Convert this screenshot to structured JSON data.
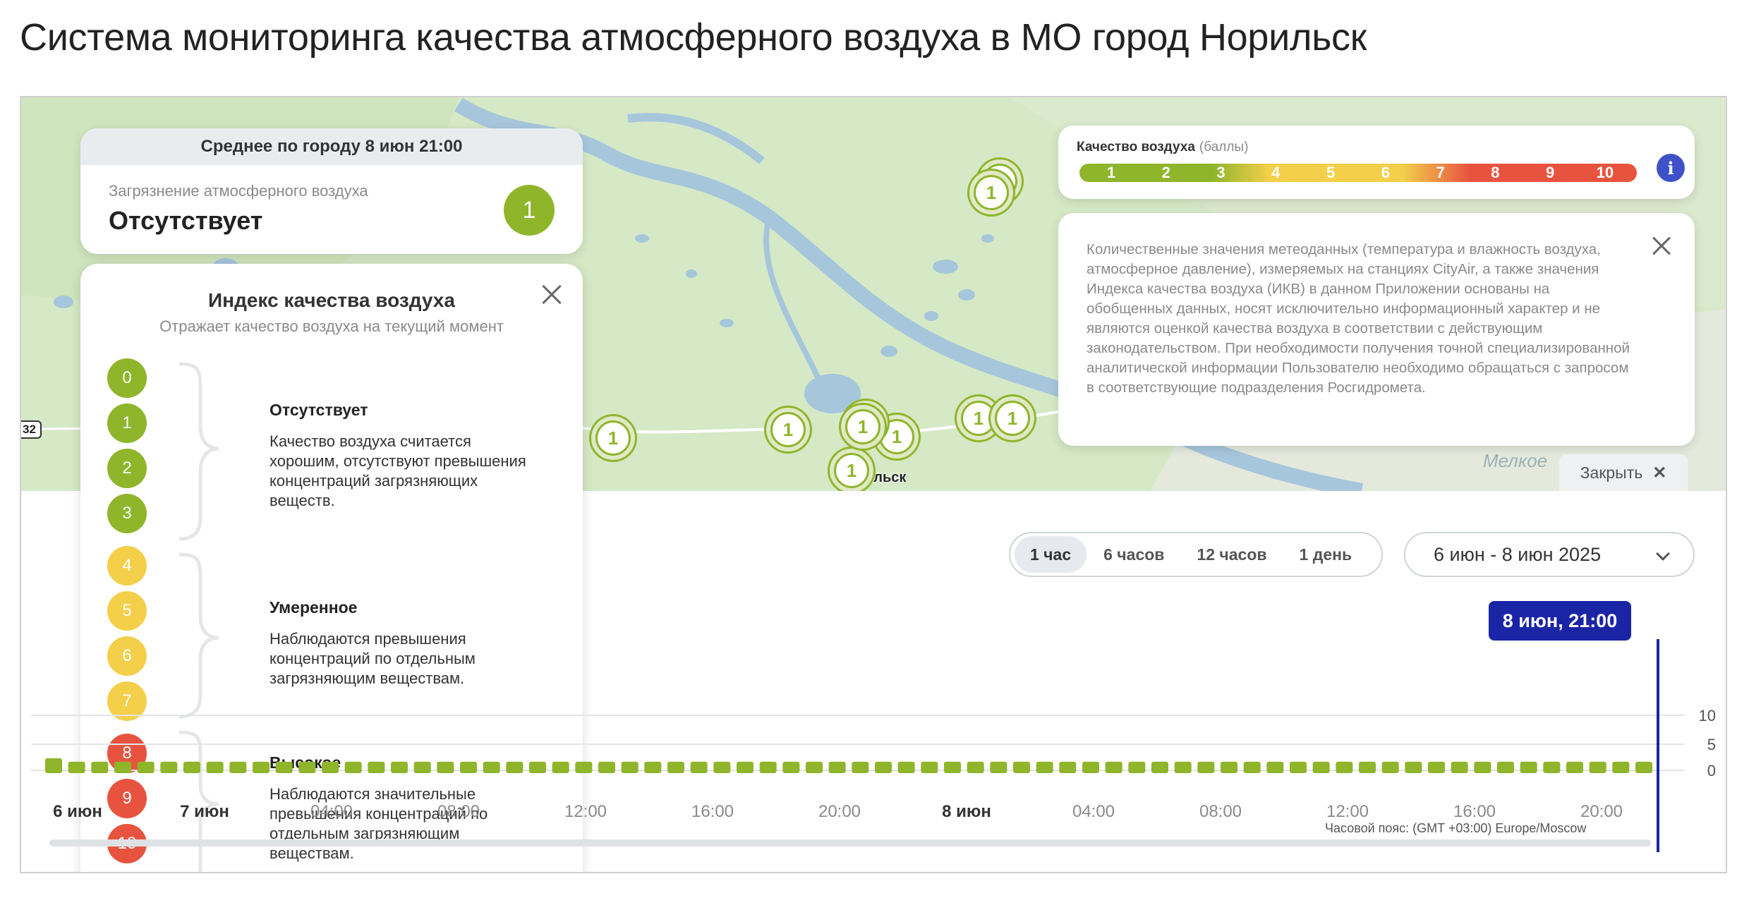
{
  "page": {
    "title": "Система мониторинга качества атмосферного воздуха в МО город Норильск"
  },
  "map": {
    "road_badge": "32",
    "water_label": "Мелкое",
    "city_label": "ильск",
    "markers": [
      "1",
      "1",
      "1",
      "1",
      "1",
      "1",
      "1",
      "1",
      "1",
      "1"
    ]
  },
  "average": {
    "header": "Среднее по городу 8 июн 21:00",
    "label": "Загрязнение атмосферного воздуха",
    "value": "Отсутствует",
    "index": "1",
    "color": "#8fb52b"
  },
  "index_panel": {
    "title": "Индекс качества воздуха",
    "subtitle": "Отражает качество воздуха на текущий момент",
    "levels": [
      {
        "value": "0",
        "color": "#8fb52b"
      },
      {
        "value": "1",
        "color": "#8fb52b"
      },
      {
        "value": "2",
        "color": "#8fb52b"
      },
      {
        "value": "3",
        "color": "#8fb52b"
      },
      {
        "value": "4",
        "color": "#f3cf4a"
      },
      {
        "value": "5",
        "color": "#f3cf4a"
      },
      {
        "value": "6",
        "color": "#f3cf4a"
      },
      {
        "value": "7",
        "color": "#f3cf4a"
      },
      {
        "value": "8",
        "color": "#e8533f"
      },
      {
        "value": "9",
        "color": "#e8533f"
      },
      {
        "value": "10",
        "color": "#e8533f"
      }
    ],
    "categories": [
      {
        "title": "Отсутствует",
        "description": "Качество воздуха считается хорошим, отсутствуют превышения концентраций загрязняющих веществ."
      },
      {
        "title": "Умеренное",
        "description": "Наблюдаются превышения концентраций по отдельным загрязняющим веществам."
      },
      {
        "title": "Высокое",
        "description": "Наблюдаются значительные превышения концентраций по отдельным загрязняющим веществам."
      }
    ]
  },
  "legend": {
    "title": "Качество воздуха",
    "unit": "(баллы)",
    "values": [
      "1",
      "2",
      "3",
      "4",
      "5",
      "6",
      "7",
      "8",
      "9",
      "10"
    ],
    "info_icon": "info-icon"
  },
  "disclaimer": {
    "text": "Количественные значения метеоданных (температура и влажность воздуха, атмосферное давление), измеряемых на станциях CityAir, а также значения Индекса качества воздуха (ИКВ) в данном Приложении основаны на обобщенных данных, носят исключительно информационный характер и не являются оценкой качества воздуха в соответствии с действующим законодательством. При необходимости получения точной специализированной аналитической информации Пользователю необходимо обращаться с запросом в соответствующие подразделения Росгидромета."
  },
  "close_button": {
    "label": "Закрыть",
    "icon": "close-icon"
  },
  "controls": {
    "intervals": [
      "1 час",
      "6 часов",
      "12 часов",
      "1 день"
    ],
    "active_interval": "1 час",
    "date_range": "6 июн - 8 июн 2025"
  },
  "chart_data": {
    "type": "bar",
    "tooltip": "8 июн, 21:00",
    "y_ticks": [
      "10",
      "5",
      "0"
    ],
    "ylim": [
      0,
      10
    ],
    "x_tick_labels": [
      "6 июн",
      "7 июн",
      "04:00",
      "08:00",
      "12:00",
      "16:00",
      "20:00",
      "8 июн",
      "04:00",
      "08:00",
      "12:00",
      "16:00",
      "20:00"
    ],
    "bold_ticks": [
      "6 июн",
      "7 июн",
      "8 июн"
    ],
    "values_note_visible": "all bars show index 1",
    "bar_count": 70,
    "bar_value": 1,
    "first_bar_value": 1.6,
    "color": "#8fb52b"
  },
  "timezone": "Часовой пояс: (GMT +03:00) Europe/Moscow"
}
